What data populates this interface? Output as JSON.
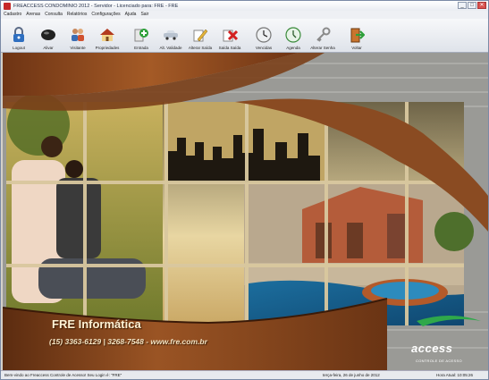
{
  "window": {
    "title": "FREACCESS CONDOMINIO 2012 - Servidor - Licenciado para: FRE - FRE",
    "controls": [
      "_",
      "□",
      "✕"
    ]
  },
  "menu": [
    "Cadastro",
    "Arenas",
    "Consulta",
    "Relatórios",
    "Configurações",
    "Ajuda",
    "Sair"
  ],
  "toolbar": [
    {
      "label": "Logout",
      "icon": "padlock-icon"
    },
    {
      "label": "Alivar",
      "icon": "black-device-icon"
    },
    {
      "label": "Visitante",
      "icon": "visitor-people-icon"
    },
    {
      "label": "Propriedades",
      "icon": "house-icon"
    },
    {
      "label": "Entrada",
      "icon": "green-plus-entry-icon"
    },
    {
      "label": "Alt. Validade",
      "icon": "car-validity-icon"
    },
    {
      "label": "Alterar Saída",
      "icon": "pencil-edit-icon"
    },
    {
      "label": "Saída Saída",
      "icon": "red-x-exit-icon"
    },
    {
      "label": "Vencidas",
      "icon": "clock-expired-icon"
    },
    {
      "label": "Agenda",
      "icon": "clock-agenda-icon"
    },
    {
      "label": "Alterar Senha",
      "icon": "key-password-icon"
    },
    {
      "label": "Voltar",
      "icon": "exit-door-icon"
    }
  ],
  "banner": {
    "company": "FRE Informática",
    "contact": "(15) 3363-6129 | 3268-7548 - www.fre.com.br",
    "logo_text": "access",
    "logo_prefix": "FRE",
    "logo_sub": "CONTROLE DE ACESSO"
  },
  "status": {
    "welcome": "Bem-vindo ao Freaccess Controle de Acesso! Seu Login é: \"FRE\"",
    "date": "terça-feira, 26 de junho de 2012",
    "time": "Hora Atual: 10:05:26"
  },
  "colors": {
    "wood": "#8a4b22",
    "wood_dark": "#5c2c10",
    "wall": "#9b9b97",
    "accent_red": "#c62828"
  }
}
